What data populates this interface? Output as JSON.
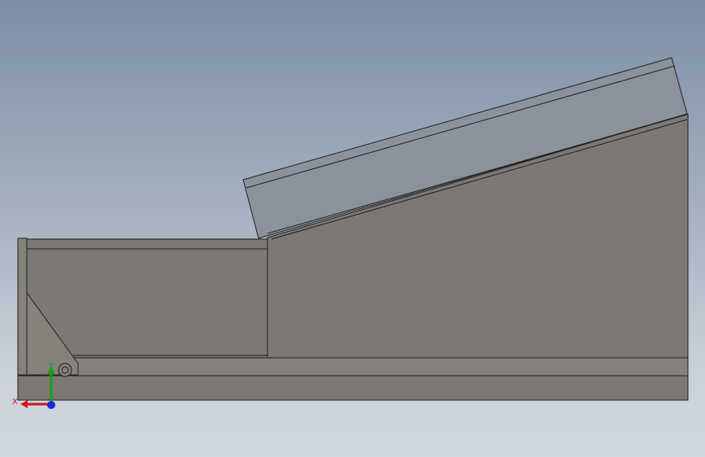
{
  "colors": {
    "part_body": "#7d7873",
    "part_body_light": "#86817b",
    "edge": "#1f1f1f",
    "cover": "#8a929c",
    "cover_face": "#939ba5",
    "axis_x": "#d01818",
    "axis_y": "#18a018",
    "axis_z": "#1a2bd0"
  },
  "triad": {
    "x_label": "X",
    "y_label": "Y"
  }
}
